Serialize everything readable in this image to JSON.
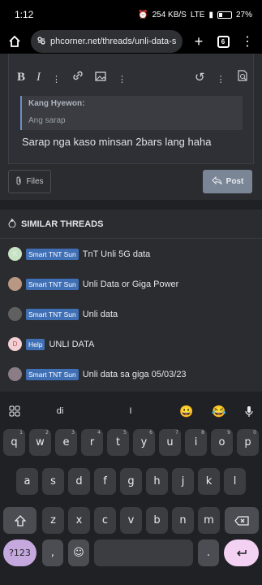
{
  "status": {
    "time": "1:12",
    "network": "254 KB/S",
    "signal": "LTE",
    "battery": "27%"
  },
  "browser": {
    "url": "phcorner.net/threads/unli-data-s",
    "tab_count": "6"
  },
  "editor": {
    "quote_author": "Kang Hyewon:",
    "quote_text": "Ang sarap",
    "reply_text": "Sarap nga kaso minsan 2bars lang haha"
  },
  "actions": {
    "files_label": "Files",
    "post_label": "Post"
  },
  "similar": {
    "header": "SIMILAR THREADS",
    "threads": [
      {
        "tag": "Smart TNT Sun",
        "title": "TnT Unli 5G data",
        "avatar": "K",
        "avatar_color": "#c7e3c4"
      },
      {
        "tag": "Smart TNT Sun",
        "title": "Unli Data or Giga Power",
        "avatar": "",
        "avatar_color": "#b99883"
      },
      {
        "tag": "Smart TNT Sun",
        "title": "Unli data",
        "avatar": "",
        "avatar_color": "#606060"
      },
      {
        "tag": "Help",
        "title": "UNLI DATA",
        "avatar": "D",
        "avatar_color": "#f2d0d3"
      },
      {
        "tag": "Smart TNT Sun",
        "title": "Unli data sa giga 05/03/23",
        "avatar": "",
        "avatar_color": "#8b7d86"
      }
    ]
  },
  "keyboard": {
    "suggestions": [
      "di",
      "I"
    ],
    "row1": [
      [
        "q",
        "1"
      ],
      [
        "w",
        "2"
      ],
      [
        "e",
        "3"
      ],
      [
        "r",
        "4"
      ],
      [
        "t",
        "5"
      ],
      [
        "y",
        "6"
      ],
      [
        "u",
        "7"
      ],
      [
        "i",
        "8"
      ],
      [
        "o",
        "9"
      ],
      [
        "p",
        "0"
      ]
    ],
    "row2": [
      "a",
      "s",
      "d",
      "f",
      "g",
      "h",
      "j",
      "k",
      "l"
    ],
    "row3": [
      "z",
      "x",
      "c",
      "v",
      "b",
      "n",
      "m"
    ],
    "symbols_label": "?123",
    "comma": ",",
    "period": "."
  },
  "colors": {
    "accent": "#3f6fb5",
    "post_button": "#7a8596"
  }
}
